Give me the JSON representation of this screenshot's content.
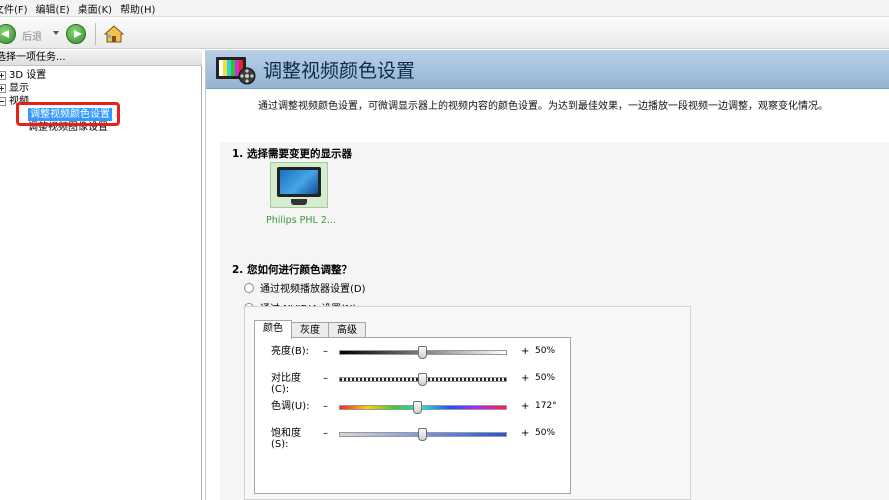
{
  "menu": [
    {
      "label": "文件(F)"
    },
    {
      "label": "编辑(E)"
    },
    {
      "label": "桌面(K)"
    },
    {
      "label": "帮助(H)"
    }
  ],
  "toolbar": {
    "back_label": "后退",
    "icons": {
      "back": "back-arrow-icon",
      "forward": "forward-arrow-icon",
      "home": "home-icon"
    }
  },
  "left_panel": {
    "header": "选择一项任务...",
    "tree": [
      {
        "label": "3D 设置",
        "expanded": false
      },
      {
        "label": "显示",
        "expanded": false
      },
      {
        "label": "视频",
        "expanded": true,
        "children": [
          {
            "label": "调整视频颜色设置",
            "selected": true
          },
          {
            "label": "调整视频图像设置",
            "selected": false
          }
        ]
      }
    ],
    "highlight_color": "#e8201a",
    "selection_color": "#3399ff"
  },
  "right_panel": {
    "title": "调整视频颜色设置",
    "description": "通过调整视频颜色设置，可微调显示器上的视频内容的颜色设置。为达到最佳效果，一边播放一段视频一边调整，观察变化情况。",
    "section1": {
      "title": "1. 选择需要变更的显示器",
      "monitor_label": "Philips PHL 2..."
    },
    "section2": {
      "title": "2. 您如何进行颜色调整？",
      "options": [
        {
          "label": "通过视频播放器设置(D)",
          "checked": false
        },
        {
          "label": "通过 NVIDIA 设置(N)",
          "checked": true
        }
      ]
    },
    "tabs": [
      {
        "label": "颜色",
        "active": true
      },
      {
        "label": "灰度",
        "active": false
      },
      {
        "label": "高级",
        "active": false
      }
    ],
    "sliders": [
      {
        "label": "亮度(B):",
        "minus": "–",
        "plus": "+",
        "value_text": "50%",
        "fraction": 0.5
      },
      {
        "label": "对比度\n(C):",
        "minus": "–",
        "plus": "+",
        "value_text": "50%",
        "fraction": 0.5
      },
      {
        "label": "色调(U):",
        "minus": "–",
        "plus": "+",
        "value_text": "172°",
        "fraction": 0.47
      },
      {
        "label": "饱和度\n(S):",
        "minus": "–",
        "plus": "+",
        "value_text": "50%",
        "fraction": 0.5
      }
    ],
    "colors": {
      "banner": "#a6c1dc",
      "monitor_label": "#3a9a3a"
    }
  }
}
